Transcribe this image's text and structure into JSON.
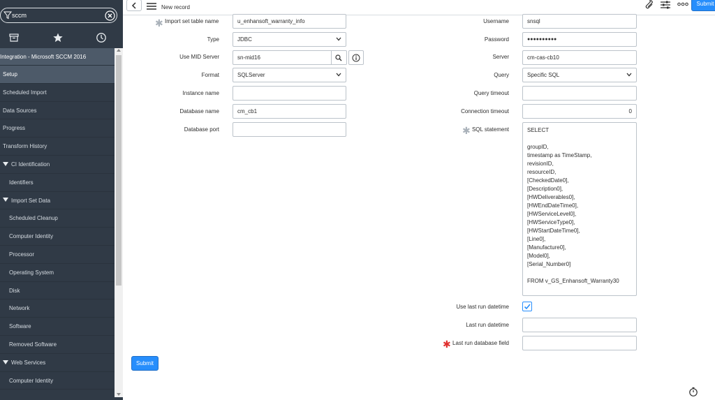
{
  "sidebar": {
    "filter_value": "sccm",
    "tabs": [
      {
        "icon": "archive-icon"
      },
      {
        "icon": "star-icon"
      },
      {
        "icon": "history-icon"
      }
    ],
    "header": "Integration - Microsoft SCCM 2016",
    "items": [
      {
        "label": "Setup",
        "active": true,
        "level": 0
      },
      {
        "label": "Scheduled Import",
        "level": 0
      },
      {
        "label": "Data Sources",
        "level": 0
      },
      {
        "label": "Progress",
        "level": 0
      },
      {
        "label": "Transform History",
        "level": 0
      },
      {
        "label": "CI Identification",
        "level": 0,
        "expanded": true
      },
      {
        "label": "Identifiers",
        "level": 1
      },
      {
        "label": "Import Set Data",
        "level": 0,
        "expanded": true
      },
      {
        "label": "Scheduled Cleanup",
        "level": 1
      },
      {
        "label": "Computer Identity",
        "level": 1
      },
      {
        "label": "Processor",
        "level": 1
      },
      {
        "label": "Operating System",
        "level": 1
      },
      {
        "label": "Disk",
        "level": 1
      },
      {
        "label": "Network",
        "level": 1
      },
      {
        "label": "Software",
        "level": 1
      },
      {
        "label": "Removed Software",
        "level": 1
      },
      {
        "label": "Web Services",
        "level": 0,
        "expanded": true
      },
      {
        "label": "Computer Identity",
        "level": 1
      }
    ]
  },
  "header": {
    "title": "New record",
    "submit_label": "Submit"
  },
  "form": {
    "left": {
      "import_set_table_name": {
        "label": "Import set table name",
        "value": "u_enhansoft_warranty_info"
      },
      "type": {
        "label": "Type",
        "value": "JDBC"
      },
      "use_mid_server": {
        "label": "Use MID Server",
        "value": "sn-mid16"
      },
      "format": {
        "label": "Format",
        "value": "SQLServer"
      },
      "instance_name": {
        "label": "Instance name",
        "value": ""
      },
      "database_name": {
        "label": "Database name",
        "value": "cm_cb1"
      },
      "database_port": {
        "label": "Database port",
        "value": ""
      }
    },
    "right": {
      "username": {
        "label": "Username",
        "value": "snsql"
      },
      "password": {
        "label": "Password",
        "value": "●●●●●●●●●●"
      },
      "server": {
        "label": "Server",
        "value": "cm-cas-cb10"
      },
      "query": {
        "label": "Query",
        "value": "Specific SQL"
      },
      "query_timeout": {
        "label": "Query timeout",
        "value": ""
      },
      "connection_timeout": {
        "label": "Connection timeout",
        "value": "0"
      },
      "sql_statement": {
        "label": "SQL statement",
        "lines": [
          "SELECT",
          "",
          "groupID,",
          "timestamp as TimeStamp,",
          "revisionID,",
          "resourceID,",
          "[CheckedDate0],",
          "[Description0],",
          "[HWDeliverables0],",
          "[HWEndDateTime0],",
          "[HWServiceLevel0],",
          "[HWServiceType0],",
          "[HWStartDateTime0],",
          "[Line0],",
          "[Manufacture0],",
          "[Model0],",
          "[Serial_Number0]",
          "",
          "FROM v_GS_Enhansoft_Warranty30"
        ]
      },
      "use_last_run_datetime": {
        "label": "Use last run datetime",
        "checked": true
      },
      "last_run_datetime": {
        "label": "Last run datetime",
        "value": ""
      },
      "last_run_database_field": {
        "label": "Last run database field",
        "value": ""
      }
    },
    "submit_label": "Submit"
  },
  "colors": {
    "sidebar_bg": "#303a46",
    "sidebar_active": "#4d5a69",
    "accent": "#278efc",
    "mandatory_red": "#e0302f"
  }
}
